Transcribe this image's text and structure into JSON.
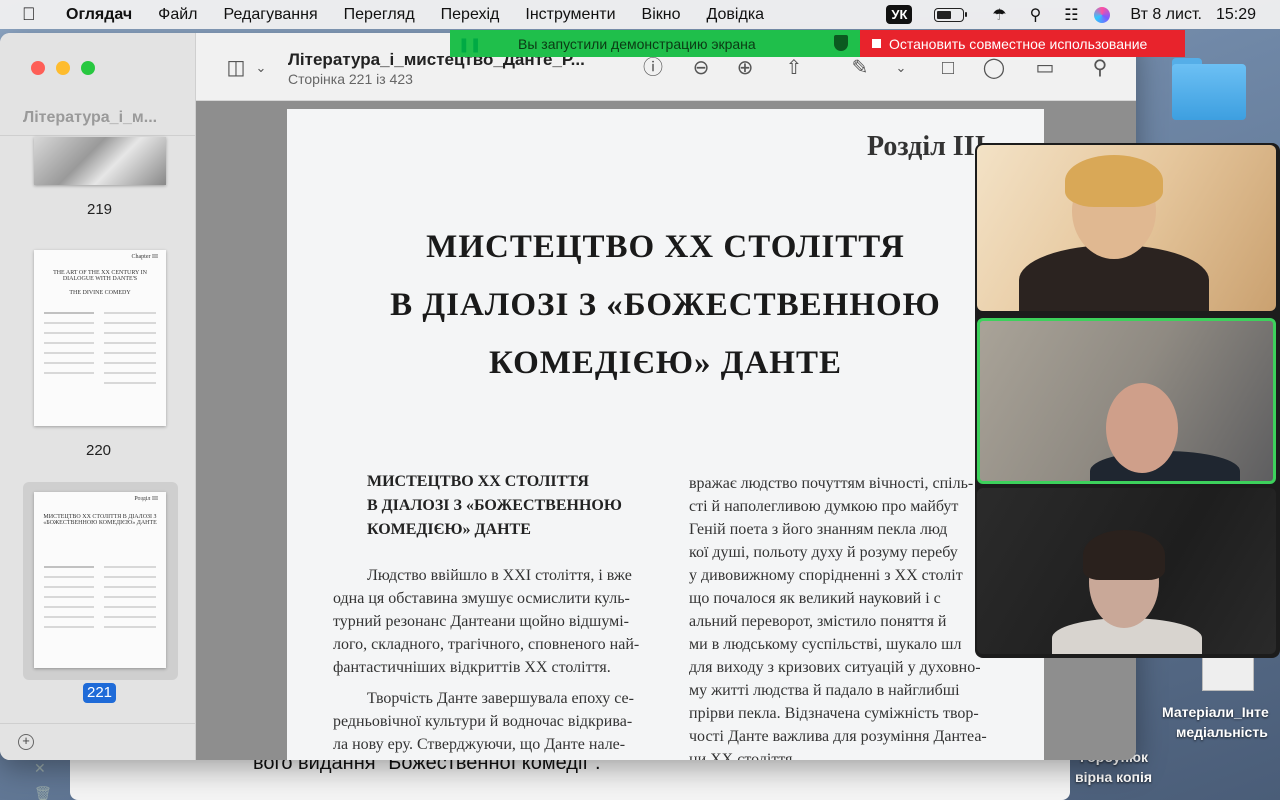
{
  "menubar": {
    "app_name": "Оглядач",
    "items": [
      "Файл",
      "Редагування",
      "Перегляд",
      "Перехід",
      "Інструменти",
      "Вікно",
      "Довідка"
    ],
    "keyboard": "УК",
    "date": "Вт 8 лист.",
    "time": "15:29",
    "battery_level": 0.6
  },
  "share_banner": {
    "message": "Вы запустили демонстрацию экрана",
    "stop_label": "Остановить совместное использование"
  },
  "preview": {
    "sidebar_title": "Література_і_м...",
    "doc_title": "Література_і_мистецтво_Данте_Р...",
    "doc_subtitle": "Сторінка 221 із 423",
    "thumbnails": [
      {
        "label": "219"
      },
      {
        "label": "220",
        "title": "THE ART OF THE XX CENTURY IN DIALOGUE WITH DANTE'S",
        "subtitle": "THE DIVINE COMEDY",
        "chapter": "Chapter III"
      },
      {
        "label": "221",
        "title": "МИСТЕЦТВО XX СТОЛІТТЯ В ДІАЛОЗІ З «БОЖЕСТВЕННОЮ КОМЕДІЄЮ» ДАНТЕ",
        "chapter": "Розділ III"
      }
    ],
    "selected_page": "221"
  },
  "page": {
    "chapter": "Розділ III",
    "title_lines": [
      "МИСТЕЦТВО XX СТОЛІТТЯ",
      "В ДІАЛОЗІ З «БОЖЕСТВЕННОЮ",
      "КОМЕДІЄЮ» ДАНТЕ"
    ],
    "subtitle_lines": [
      "МИСТЕЦТВО XX СТОЛІТТЯ",
      "В ДІАЛОЗІ З «БОЖЕСТВЕННОЮ",
      "КОМЕДІЄЮ» ДАНТЕ"
    ],
    "left_col": [
      "Людство ввійшло в XXI століття, і вже",
      "одна ця обставина змушує осмислити куль-",
      "турний резонанс Дантеани щойно відшумі-",
      "лого, складного, трагічного, сповненого най-",
      "фантастичніших відкриттів XX століття.",
      "Творчість Данте завершувала епоху се-",
      "редньовічної культури й водночас відкрива-",
      "ла нову еру. Стверджуючи, що Данте нале-"
    ],
    "right_col": [
      "вражає людство почуттям вічності, спіль-",
      "сті й наполегливою думкою про майбут",
      "Геній поета з його знанням пекла люд",
      "кої душі, польоту духу й розуму перебу",
      "у дивовижному спорідненні з XX століт",
      "що почалося як великий науковий і с",
      "альний переворот, змістило поняття й",
      "ми в людському суспільстві, шукало шл",
      "для виходу з кризових ситуацій у духовно-",
      "му житті людства й падало в найглибші",
      "прірви пекла. Відзначена суміжність твор-",
      "чості Данте важлива для розуміння Дантеа-",
      "ни XX століття"
    ]
  },
  "background": {
    "window_text": "вого видання \"Божественної комедії\"."
  },
  "desktop": {
    "right_labels": [
      "Матеріали_Інте",
      "медіальність",
      "Горбунюк",
      "вірна копія"
    ]
  },
  "colors": {
    "share_green": "#1fbf4b",
    "share_red": "#e8232c",
    "accent_blue": "#1f6bd8",
    "active_speaker": "#3dd15c"
  }
}
